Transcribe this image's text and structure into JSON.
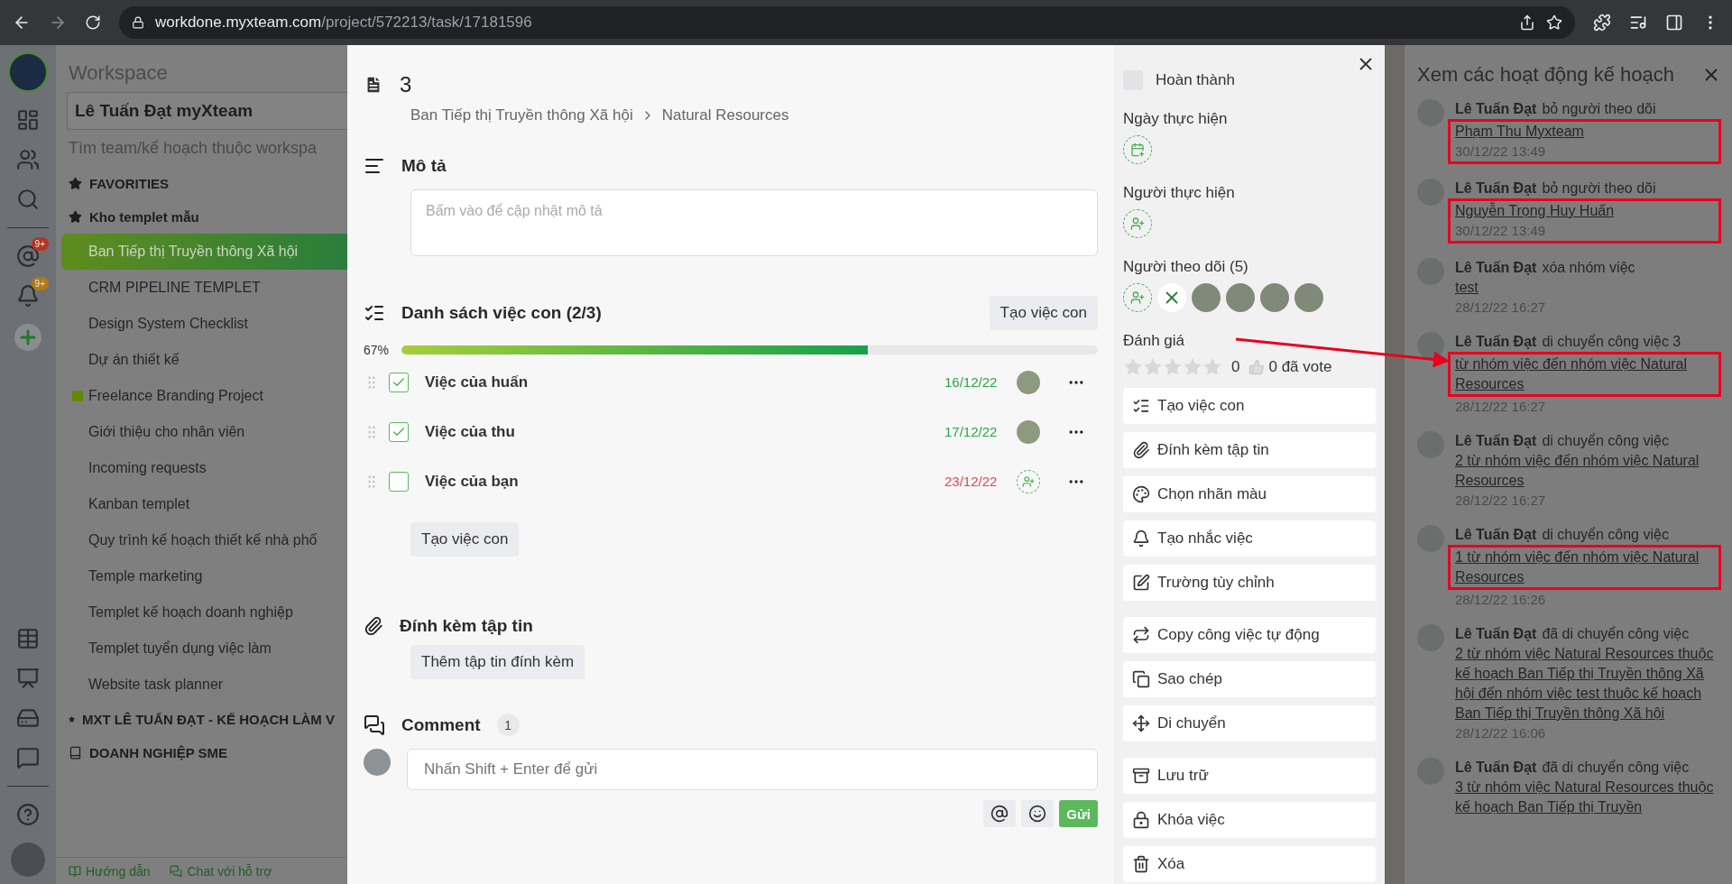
{
  "browser": {
    "domain": "workdone.myxteam.com",
    "path": "/project/572213/task/17181596"
  },
  "rail": {
    "mentions_badge": "9+",
    "notifications_badge": "9+"
  },
  "sidebar": {
    "title": "Workspace",
    "workspace": "Lê Tuấn Đạt myXteam",
    "search_placeholder": "Tìm team/kế hoạch thuộc workspa",
    "sections": [
      {
        "kind": "star",
        "label": "FAVORITIES"
      },
      {
        "kind": "star",
        "label": "Kho templet mẫu",
        "items": [
          {
            "label": "Ban Tiếp thị Truyền thông Xã hội",
            "selected": true
          },
          {
            "label": "CRM PIPELINE TEMPLET",
            "selected": false
          },
          {
            "label": "Design System Checklist",
            "selected": false
          },
          {
            "label": "Dự án thiết kế",
            "selected": false
          },
          {
            "label": "Freelance Branding Project",
            "selected": false,
            "color": "#5f8a00"
          },
          {
            "label": "Giới thiệu cho nhân viên",
            "selected": false
          },
          {
            "label": "Incoming requests",
            "selected": false
          },
          {
            "label": "Kanban templet",
            "selected": false
          },
          {
            "label": "Quy trình kế hoạch thiết kế nhà phố",
            "selected": false
          },
          {
            "label": "Temple marketing",
            "selected": false
          },
          {
            "label": "Templet kế hoạch doanh nghiệp",
            "selected": false
          },
          {
            "label": "Templet tuyển dụng việc làm",
            "selected": false
          },
          {
            "label": "Website task planner",
            "selected": false
          }
        ]
      },
      {
        "kind": "star",
        "label": "MXT LÊ TUẤN ĐẠT - KẾ HOẠCH LÀM V"
      },
      {
        "kind": "book",
        "label": "DOANH NGHIỆP SME"
      }
    ],
    "footer": [
      "Hướng dẫn",
      "Chat với hỗ trợ"
    ]
  },
  "task": {
    "title": "3",
    "breadcrumb": [
      "Ban Tiếp thị Truyền thông Xã hội",
      "Natural Resources"
    ],
    "description": {
      "heading": "Mô tả",
      "placeholder": "Bấm vào để cập nhật mô tả"
    },
    "subtasks": {
      "heading": "Danh sách việc con (2/3)",
      "add_button": "Tạo việc con",
      "percent": "67%",
      "level": 0.67,
      "items": [
        {
          "name": "Việc của huấn",
          "checked": true,
          "date": "16/12/22",
          "overdue": false,
          "assigned": true
        },
        {
          "name": "Việc của thu",
          "checked": true,
          "date": "17/12/22",
          "overdue": false,
          "assigned": true
        },
        {
          "name": "Việc của bạn",
          "checked": false,
          "date": "23/12/22",
          "overdue": true,
          "assigned": false
        }
      ],
      "bottom_button": "Tạo việc con"
    },
    "attachments": {
      "heading": "Đính kèm tập tin",
      "button": "Thêm tập tin đính kèm"
    },
    "comments": {
      "heading": "Comment",
      "count": "1",
      "placeholder": "Nhấn Shift + Enter để gửi",
      "send": "Gửi"
    }
  },
  "side": {
    "done": {
      "label": "Hoàn thành",
      "checked": false
    },
    "date_label": "Ngày thực hiện",
    "assignee_label": "Người thực hiện",
    "followers": {
      "label": "Người theo dõi (5)",
      "avatars": [
        {
          "kind": "logo"
        },
        {
          "kind": "photo"
        },
        {
          "kind": "photo"
        },
        {
          "kind": "photo"
        },
        {
          "kind": "photo"
        }
      ]
    },
    "rating": {
      "label": "Đánh giá",
      "stars": 0,
      "score": "0",
      "votes": "0 đã vote"
    },
    "action_groups": [
      [
        {
          "kind": "subtask",
          "label": "Tạo việc con"
        },
        {
          "kind": "attach",
          "label": "Đính kèm tập tin"
        },
        {
          "kind": "label",
          "label": "Chọn nhãn màu"
        },
        {
          "kind": "reminder",
          "label": "Tạo nhắc việc"
        },
        {
          "kind": "custom",
          "label": "Trường tùy chỉnh"
        }
      ],
      [
        {
          "kind": "autocopy",
          "label": "Copy công việc tự động"
        },
        {
          "kind": "copy",
          "label": "Sao chép"
        },
        {
          "kind": "move",
          "label": "Di chuyển"
        }
      ],
      [
        {
          "kind": "archive",
          "label": "Lưu trữ"
        },
        {
          "kind": "lock",
          "label": "Khóa việc"
        },
        {
          "kind": "delete",
          "label": "Xóa"
        }
      ]
    ]
  },
  "activity": {
    "title": "Xem các hoạt động kế hoạch",
    "annotation_arrow": true,
    "entries": [
      {
        "actor": "Lê Tuấn Đạt",
        "action": "bỏ người theo dõi",
        "link": "Phạm Thu Myxteam",
        "time": "30/12/22 13:49",
        "link_boxed": true,
        "time_boxed": true
      },
      {
        "actor": "Lê Tuấn Đạt",
        "action": "bỏ người theo dõi",
        "link": "Nguyễn Trọng Huy Huấn",
        "time": "30/12/22 13:49",
        "link_boxed": true,
        "time_boxed": true
      },
      {
        "actor": "Lê Tuấn Đạt",
        "action": "xóa nhóm việc",
        "link": "test",
        "time": "28/12/22 16:27",
        "link_boxed": false,
        "time_boxed": false
      },
      {
        "actor": "Lê Tuấn Đạt",
        "action": "di chuyển công việc 3",
        "link": "từ nhóm việc đến nhóm việc Natural Resources",
        "time": "28/12/22 16:27",
        "link_boxed": true,
        "time_boxed": false
      },
      {
        "actor": "Lê Tuấn Đạt",
        "action": "di chuyển công việc",
        "link": "2 từ nhóm việc đến nhóm việc Natural Resources",
        "time": "28/12/22 16:27",
        "link_boxed": false,
        "time_boxed": false
      },
      {
        "actor": "Lê Tuấn Đạt",
        "action": "di chuyển công việc",
        "link": "1 từ nhóm việc đến nhóm việc Natural Resources",
        "time": "28/12/22 16:26",
        "link_boxed": true,
        "time_boxed": false
      },
      {
        "actor": "Lê Tuấn Đạt",
        "action": "đã di chuyển công việc",
        "link": "2 từ nhóm việc Natural Resources thuộc kế hoạch Ban Tiếp thị Truyền thông Xã hội đến nhóm việc test thuộc kế hoạch Ban Tiếp thị Truyền thông Xã hội",
        "time": "28/12/22 16:06",
        "link_boxed": false,
        "time_boxed": false
      },
      {
        "actor": "Lê Tuấn Đạt",
        "action": "đã di chuyển công việc",
        "link": "3 từ nhóm việc Natural Resources thuộc kế hoạch Ban Tiếp thị Truyền",
        "link_boxed": false,
        "time_boxed": false
      }
    ]
  }
}
